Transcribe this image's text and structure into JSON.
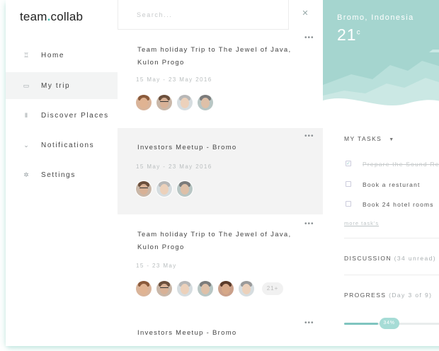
{
  "brand": {
    "name_left": "team",
    "dot": ".",
    "name_right": "collab"
  },
  "sidebar": {
    "items": [
      {
        "label": "Home",
        "icon": "trophy-icon",
        "glyph": "♖",
        "active": false
      },
      {
        "label": "My trip",
        "icon": "luggage-icon",
        "glyph": "▭",
        "active": true
      },
      {
        "label": "Discover Places",
        "icon": "column-icon",
        "glyph": "Ⅱ",
        "active": false
      },
      {
        "label": "Notifications",
        "icon": "chevron-icon",
        "glyph": "⌄",
        "active": false
      },
      {
        "label": "Settings",
        "icon": "settings-icon",
        "glyph": "✲",
        "active": false
      }
    ]
  },
  "search": {
    "placeholder": "Search...",
    "close_icon": "close-icon",
    "close_glyph": "✕"
  },
  "trips": [
    {
      "title": "Team holiday Trip to The Jewel of Java, Kulon Progo",
      "date": "15 May - 23 May 2016",
      "more": "•••",
      "extra": ""
    },
    {
      "title": "Investors Meetup - Bromo",
      "date": "15 May - 23 May 2016",
      "more": "•••",
      "extra": ""
    },
    {
      "title": "Team holiday Trip to The Jewel of Java, Kulon Progo",
      "date": "15 - 23 May",
      "more": "•••",
      "extra": "21+"
    },
    {
      "title": "Investors Meetup - Bromo",
      "date": "",
      "more": "•••",
      "extra": ""
    }
  ],
  "weather": {
    "city": "Bromo, Indonesia",
    "temp": "21",
    "unit": "c",
    "colors": {
      "sky": "#a8d6d1",
      "hills": "#c7e7e3"
    }
  },
  "tasks": {
    "title": "MY TASKS",
    "items": [
      {
        "label": "Prepare the Sound Re",
        "done": true,
        "check": "✓"
      },
      {
        "label": "Book a resturant",
        "done": false,
        "check": ""
      },
      {
        "label": "Book 24 hotel rooms",
        "done": false,
        "check": ""
      }
    ],
    "more_link": "more task's"
  },
  "discussion": {
    "label": "DISCUSSION",
    "count": "(34 unread)"
  },
  "progress": {
    "label": "PROGRESS",
    "detail": "(Day 3 of 9)",
    "value_label": "34%",
    "fraction": 0.34
  },
  "colors": {
    "accent": "#3ebfae",
    "active_bg": "#f3f4f4"
  }
}
